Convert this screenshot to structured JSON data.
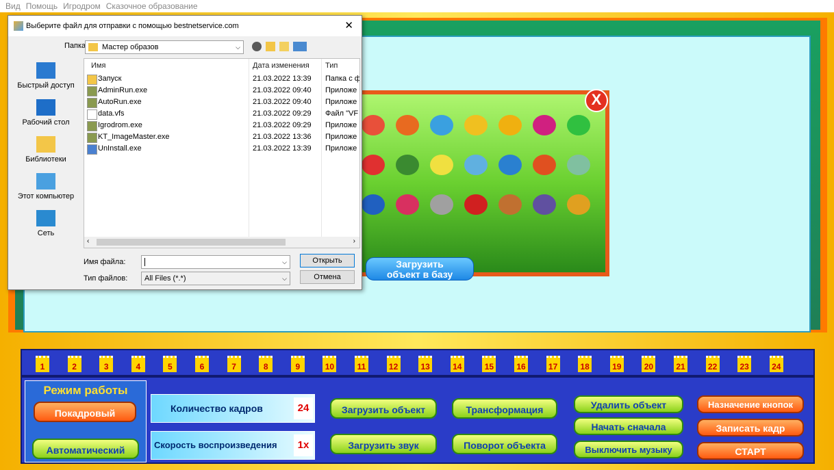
{
  "menu": [
    "Вид",
    "Помощь",
    "Игродром",
    "Сказочное образование"
  ],
  "dialog": {
    "title": "Выберите файл для отправки с помощью bestnetservice.com",
    "close": "✕",
    "folder_label": "Папка:",
    "folder_value": "Мастер образов",
    "places": [
      {
        "label": "Быстрый доступ",
        "icon": "star-icon"
      },
      {
        "label": "Рабочий стол",
        "icon": "desktop-icon"
      },
      {
        "label": "Библиотеки",
        "icon": "libraries-icon"
      },
      {
        "label": "Этот компьютер",
        "icon": "computer-icon"
      },
      {
        "label": "Сеть",
        "icon": "network-icon"
      }
    ],
    "columns": {
      "name": "Имя",
      "date": "Дата изменения",
      "type": "Тип"
    },
    "files": [
      {
        "name": "Запуск",
        "date": "21.03.2022 13:39",
        "type": "Папка с ф",
        "icon": "folder-icon"
      },
      {
        "name": "AdminRun.exe",
        "date": "21.03.2022 09:40",
        "type": "Приложе",
        "icon": "app-icon"
      },
      {
        "name": "AutoRun.exe",
        "date": "21.03.2022 09:40",
        "type": "Приложе",
        "icon": "app-icon"
      },
      {
        "name": "data.vfs",
        "date": "21.03.2022 09:29",
        "type": "Файл \"VF",
        "icon": "file-icon"
      },
      {
        "name": "Igrodrom.exe",
        "date": "21.03.2022 09:29",
        "type": "Приложе",
        "icon": "app-icon"
      },
      {
        "name": "KT_ImageMaster.exe",
        "date": "21.03.2022 13:36",
        "type": "Приложе",
        "icon": "app-icon"
      },
      {
        "name": "UnInstall.exe",
        "date": "21.03.2022 13:39",
        "type": "Приложе",
        "icon": "uninstall-icon"
      }
    ],
    "filename_label": "Имя файла:",
    "filename_value": "",
    "filetype_label": "Тип файлов:",
    "filetype_value": "All Files (*.*)",
    "open_button": "Открыть",
    "cancel_button": "Отмена"
  },
  "object_panel": {
    "close": "X",
    "load_db_button": "Загрузить\nобъект в базу"
  },
  "frames": [
    "1",
    "2",
    "3",
    "4",
    "5",
    "6",
    "7",
    "8",
    "9",
    "10",
    "11",
    "12",
    "13",
    "14",
    "15",
    "16",
    "17",
    "18",
    "19",
    "20",
    "21",
    "22",
    "23",
    "24"
  ],
  "controls": {
    "mode_title": "Режим работы",
    "mode_frame": "Покадровый",
    "mode_auto": "Автоматический",
    "frame_count_label": "Количество кадров",
    "frame_count_value": "24",
    "speed_label": "Скорость воспроизведения",
    "speed_value": "1x",
    "load_object": "Загрузить объект",
    "load_sound": "Загрузить звук",
    "transform": "Трансформация",
    "rotate": "Поворот объекта",
    "delete_object": "Удалить объект",
    "restart": "Начать сначала",
    "mute": "Выключить музыку",
    "assign_buttons": "Назначение кнопок",
    "record_frame": "Записать кадр",
    "start": "СТАРТ"
  },
  "colors": {
    "frame_orange": "#ff7a00",
    "frame_green": "#1aa060",
    "canvas": "#cbfafa",
    "strip_blue": "#2a3cc8"
  }
}
